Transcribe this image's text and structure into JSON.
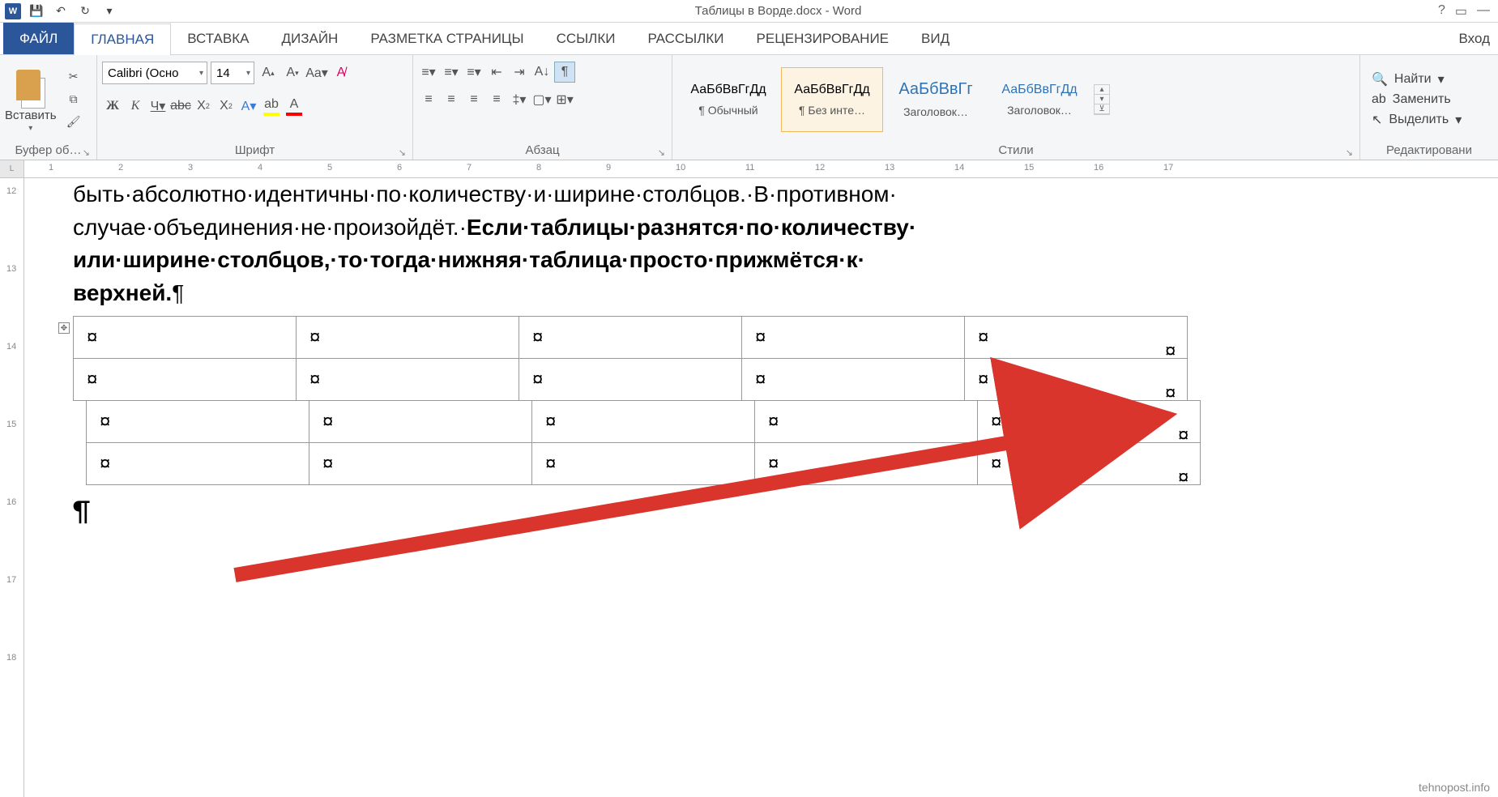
{
  "title": "Таблицы в Ворде.docx - Word",
  "qat": {
    "word": "W",
    "save": "save",
    "undo": "undo",
    "redo": "redo"
  },
  "title_right": {
    "help": "?",
    "ribbon_opts": "▭",
    "min": "—"
  },
  "tabs": {
    "file": "ФАЙЛ",
    "home": "ГЛАВНАЯ",
    "insert": "ВСТАВКА",
    "design": "ДИЗАЙН",
    "layout": "РАЗМЕТКА СТРАНИЦЫ",
    "refs": "ССЫЛКИ",
    "mail": "РАССЫЛКИ",
    "review": "РЕЦЕНЗИРОВАНИЕ",
    "view": "ВИД",
    "login": "Вход"
  },
  "groups": {
    "clipboard": "Буфер об…",
    "paste": "Вставить",
    "font": "Шрифт",
    "paragraph": "Абзац",
    "styles": "Стили",
    "editing": "Редактировани"
  },
  "font": {
    "name": "Calibri (Осно",
    "size": "14"
  },
  "style_items": [
    {
      "preview": "АаБбВвГгДд",
      "name": "¶ Обычный",
      "cls": ""
    },
    {
      "preview": "АаБбВвГгДд",
      "name": "¶ Без инте…",
      "cls": "selected"
    },
    {
      "preview": "АаБбВвГг",
      "name": "Заголовок…",
      "cls": "blue"
    },
    {
      "preview": "АаБбВвГгДд",
      "name": "Заголовок…",
      "cls": "blue2"
    }
  ],
  "editing": {
    "find": "Найти",
    "replace": "Заменить",
    "select": "Выделить"
  },
  "ruler_h": [
    "1",
    "2",
    "3",
    "4",
    "5",
    "6",
    "7",
    "8",
    "9",
    "10",
    "11",
    "12",
    "13",
    "14",
    "15",
    "16",
    "17"
  ],
  "ruler_v": [
    "12",
    "13",
    "14",
    "15",
    "16",
    "17",
    "18"
  ],
  "doc": {
    "line1": "быть·абсолютно·идентичны·по·количеству·и·ширине·столбцов.·В·противном·",
    "line2a": "случае·объединения·не·произойдёт.·",
    "line2b": "Если·таблицы·разнятся·по·количеству·",
    "line3": "или·ширине·столбцов,·то·тогда·нижняя·таблица·просто·прижмётся·к·",
    "line4": "верхней.",
    "pil": "¶",
    "cell": "¤"
  },
  "watermark": "tehnopost.info"
}
